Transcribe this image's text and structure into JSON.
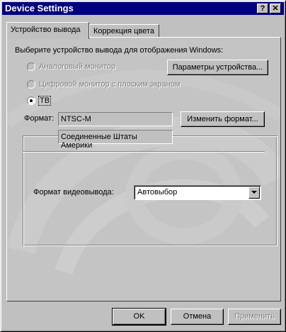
{
  "window": {
    "title": "Device Settings"
  },
  "titlebar": {
    "help_label": "?",
    "close_label": "✕"
  },
  "tabs": [
    {
      "label": "Устройство вывода",
      "active": true
    },
    {
      "label": "Коррекция цвета",
      "active": false
    }
  ],
  "output": {
    "instruction": "Выберите устройство вывода для отображения Windows:",
    "options": [
      {
        "label": "Аналоговый монитор",
        "enabled": false,
        "selected": false
      },
      {
        "label": "Цифровой монитор с плоским экраном",
        "enabled": false,
        "selected": false
      },
      {
        "label": "ТВ",
        "enabled": true,
        "selected": true
      }
    ],
    "device_params_button": "Параметры устройства..."
  },
  "tv": {
    "format_label": "Формат:",
    "format_value": "NTSC-M",
    "region_value": "Соединенные Штаты Америки",
    "change_format_button": "Изменить формат...",
    "video_output_label": "Формат видеовывода:",
    "video_output_value": "Автовыбор"
  },
  "footer": {
    "ok_label": "OK",
    "cancel_label": "Отмена",
    "apply_label": "Применить"
  },
  "icons": {
    "dropdown": "chevron-down-icon",
    "radio": "radio-icon"
  }
}
